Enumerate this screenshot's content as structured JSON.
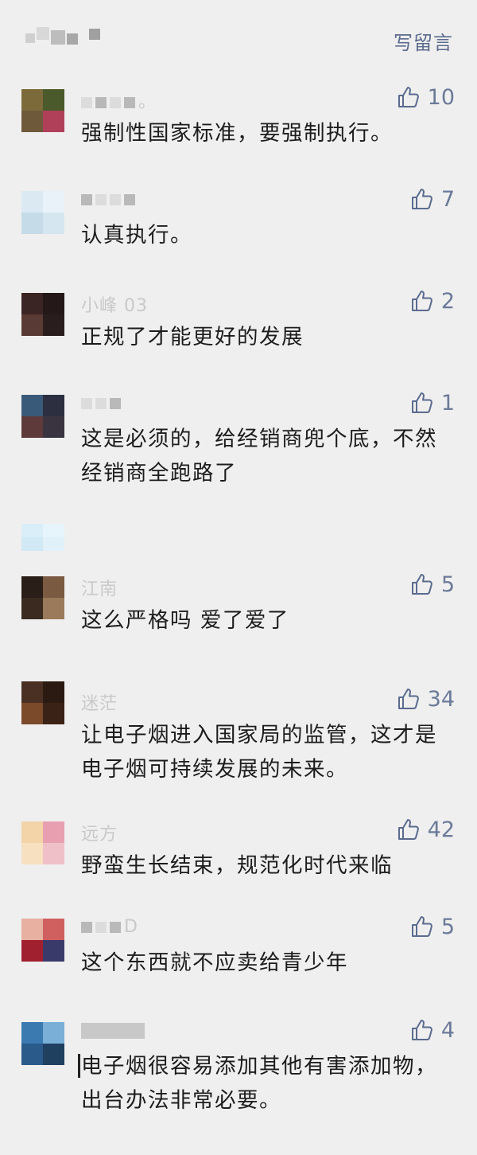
{
  "header": {
    "write_comment_label": "写留言"
  },
  "comments": [
    {
      "nickname": "。",
      "likes": "10",
      "text": "强制性国家标准，要强制执行。",
      "avatar_colors": [
        "#7d6a3a",
        "#4a5a2a",
        "#6e5a3a",
        "#b0405a"
      ]
    },
    {
      "nickname": "",
      "likes": "7",
      "text": "认真执行。",
      "avatar_colors": [
        "#dbe9f2",
        "#e9f2f8",
        "#c5dbe8",
        "#d6e6f0"
      ]
    },
    {
      "nickname": "小峰 03",
      "likes": "2",
      "text": "正规了才能更好的发展",
      "avatar_colors": [
        "#3b2424",
        "#241818",
        "#5a3a34",
        "#2a1d1d"
      ]
    },
    {
      "nickname": "",
      "likes": "1",
      "text": "这是必须的，给经销商兜个底，不然经销商全跑路了",
      "avatar_colors": [
        "#3a5a7a",
        "#2b2f3f",
        "#5e3a3a",
        "#3a3440"
      ]
    },
    {
      "nickname": "",
      "likes": "",
      "text": "",
      "avatar_colors": [
        "#d9eef8",
        "#e6f4fb",
        "#d0e9f5",
        "#e0f1f9"
      ]
    },
    {
      "nickname": "江南",
      "likes": "5",
      "text": "这么严格吗 爱了爱了",
      "avatar_colors": [
        "#2a1e18",
        "#7a5a40",
        "#3a2a20",
        "#9a7a5a"
      ]
    },
    {
      "nickname": "迷茫",
      "likes": "34",
      "text": "让电子烟进入国家局的监管，这才是电子烟可持续发展的未来。",
      "avatar_colors": [
        "#4a3022",
        "#2a1a12",
        "#7a4a2a",
        "#3a2216"
      ]
    },
    {
      "nickname": "远方",
      "likes": "42",
      "text": "野蛮生长结束，规范化时代来临",
      "avatar_colors": [
        "#f3d4a8",
        "#e8a0b0",
        "#f6e0c0",
        "#f0c0c8"
      ]
    },
    {
      "nickname": "D",
      "likes": "5",
      "text": "这个东西就不应卖给青少年",
      "avatar_colors": [
        "#e8b0a0",
        "#d06060",
        "#a02030",
        "#3a3a6a"
      ]
    },
    {
      "nickname": "",
      "likes": "4",
      "text": "电子烟很容易添加其他有害添加物，出台办法非常必要。",
      "avatar_colors": [
        "#3a7ab0",
        "#7ab0d8",
        "#2a5a8a",
        "#204060"
      ]
    }
  ]
}
